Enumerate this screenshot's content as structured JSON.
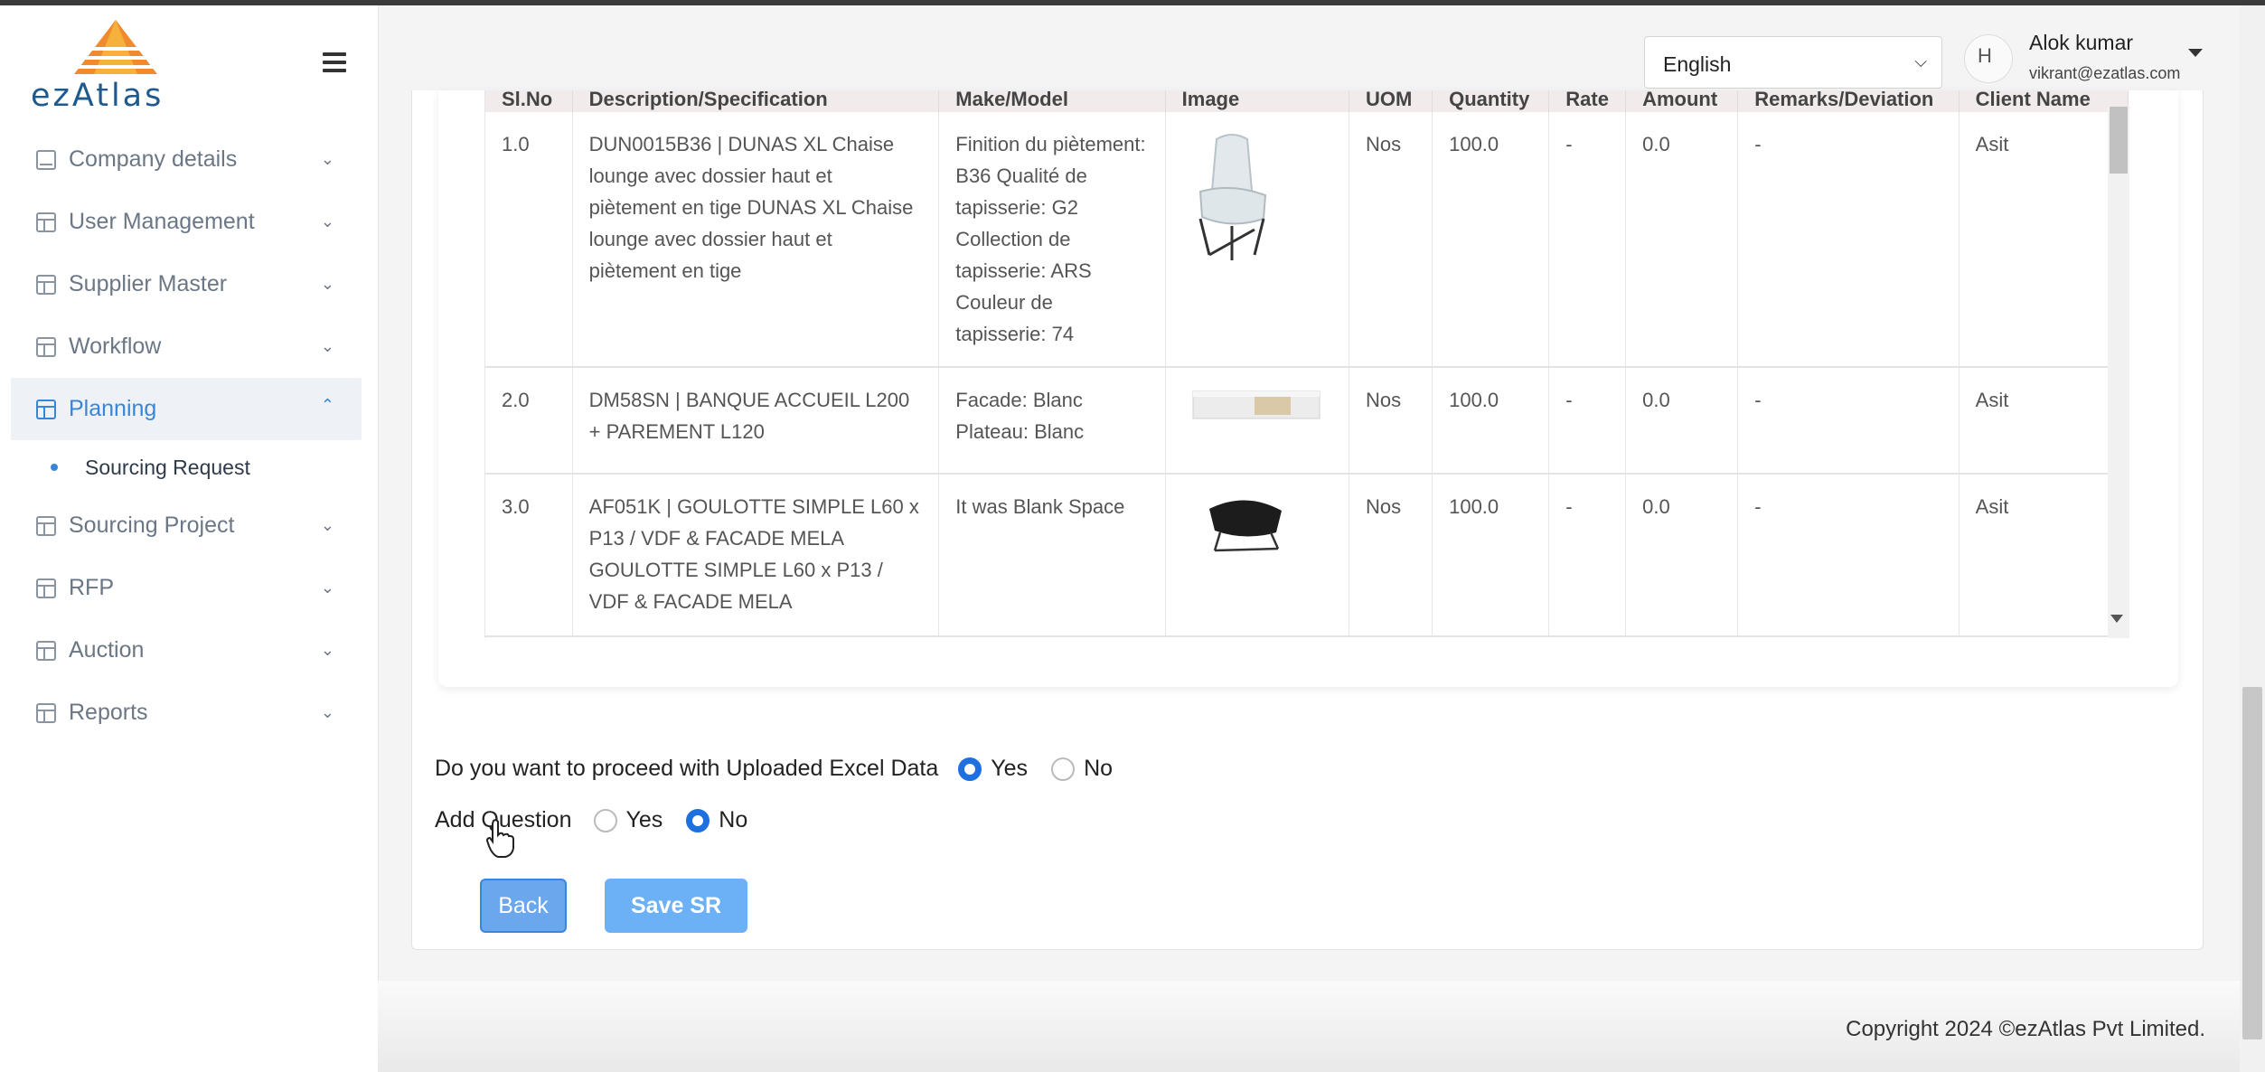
{
  "app": {
    "logo_text": "ezAtlas"
  },
  "sidebar": {
    "items": [
      {
        "label": "Company details",
        "icon": "book-icon"
      },
      {
        "label": "User Management",
        "icon": "table-icon"
      },
      {
        "label": "Supplier Master",
        "icon": "table-icon"
      },
      {
        "label": "Workflow",
        "icon": "table-icon"
      },
      {
        "label": "Planning",
        "icon": "table-icon",
        "active": true
      },
      {
        "label": "Sourcing Project",
        "icon": "table-icon"
      },
      {
        "label": "RFP",
        "icon": "table-icon"
      },
      {
        "label": "Auction",
        "icon": "table-icon"
      },
      {
        "label": "Reports",
        "icon": "table-icon"
      }
    ],
    "sub_item": "Sourcing Request"
  },
  "header": {
    "language": "English",
    "avatar_alt": "H",
    "user_name": "Alok kumar",
    "user_email": "vikrant@ezatlas.com"
  },
  "table": {
    "columns": [
      "Sl.No",
      "Description/Specification",
      "Make/Model",
      "Image",
      "UOM",
      "Quantity",
      "Rate",
      "Amount",
      "Remarks/Deviation",
      "Client Name"
    ],
    "rows": [
      {
        "sl": "1.0",
        "desc": "DUN0015B36 | DUNAS XL Chaise lounge avec dossier haut et piètement en tige DUNAS XL Chaise lounge avec dossier haut et piètement en tige",
        "make": "Finition du piètement: B36 Qualité de tapisserie: G2 Collection de tapisserie: ARS Couleur de tapisserie: 74",
        "image": "white-lounge-chair",
        "uom": "Nos",
        "qty": "100.0",
        "rate": "-",
        "amount": "0.0",
        "remarks": "-",
        "client": "Asit"
      },
      {
        "sl": "2.0",
        "desc": "DM58SN | BANQUE ACCUEIL L200 + PAREMENT L120",
        "make": "Facade: Blanc Plateau: Blanc",
        "image": "reception-desk",
        "uom": "Nos",
        "qty": "100.0",
        "rate": "-",
        "amount": "0.0",
        "remarks": "-",
        "client": "Asit"
      },
      {
        "sl": "3.0",
        "desc": "AF051K | GOULOTTE SIMPLE L60 x P13 / VDF & FACADE MELA GOULOTTE SIMPLE L60 x P13 / VDF & FACADE MELA",
        "make": "It was Blank Space",
        "image": "black-lounge-chair",
        "uom": "Nos",
        "qty": "100.0",
        "rate": "-",
        "amount": "0.0",
        "remarks": "-",
        "client": "Asit"
      }
    ]
  },
  "form": {
    "proceed_question": "Do you want to proceed with Uploaded Excel Data",
    "proceed_selected": "Yes",
    "add_question": "Add Question",
    "add_selected": "No",
    "yes_label": "Yes",
    "no_label": "No"
  },
  "buttons": {
    "back": "Back",
    "save": "Save SR"
  },
  "footer": {
    "copyright": "Copyright 2024 ©ezAtlas Pvt Limited."
  },
  "colors": {
    "accent": "#3a86d6",
    "button": "#6cb0f5",
    "radio": "#1e6fe0"
  }
}
